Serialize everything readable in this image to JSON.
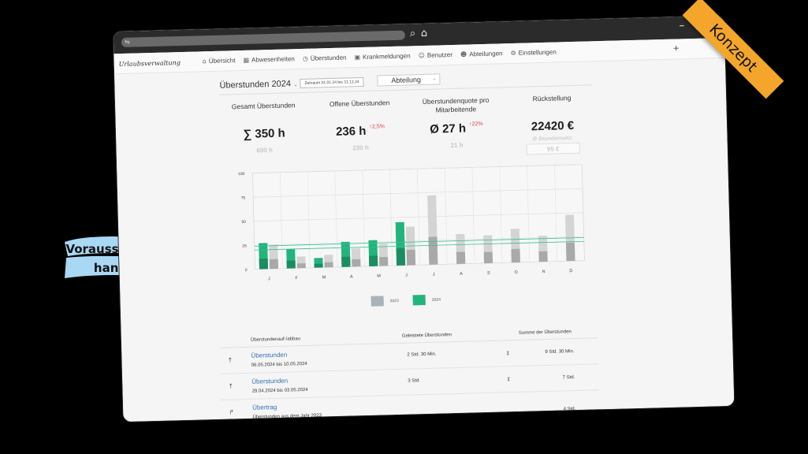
{
  "browser": {
    "icons": [
      "search-icon",
      "home-icon"
    ],
    "window_controls": [
      "minimize-icon",
      "maximize-icon",
      "close-icon"
    ]
  },
  "app": {
    "brand": "Urlaubsverwaltung"
  },
  "nav": {
    "items": [
      {
        "label": "Übersicht",
        "icon": "home-icon"
      },
      {
        "label": "Abwesenheiten",
        "icon": "calendar-icon"
      },
      {
        "label": "Überstunden",
        "icon": "clock-icon"
      },
      {
        "label": "Krankmeldungen",
        "icon": "medical-icon"
      },
      {
        "label": "Benutzer",
        "icon": "user-icon"
      },
      {
        "label": "Abteilungen",
        "icon": "users-icon"
      },
      {
        "label": "Einstellungen",
        "icon": "gear-icon"
      }
    ],
    "plus": "+"
  },
  "filters": {
    "year": "Überstunden 2024",
    "period": "Zeitraum 01.01.24 bis 31.12.24",
    "department": "Abteilung"
  },
  "kpis": [
    {
      "label": "Gesamt Überstunden",
      "value": "∑ 350 h",
      "trend": "",
      "previous": "600 h"
    },
    {
      "label": "Offene Überstunden",
      "value": "236 h",
      "trend": "↑2,5%",
      "previous": "230 h"
    },
    {
      "label": "Überstundenquote pro Mitarbeitende",
      "value": "Ø 27 h",
      "trend": "↑22%",
      "previous": "21 h"
    },
    {
      "label": "Rückstellung",
      "value": "22420 €",
      "trend": "",
      "sub_label": "Ø Stundensatz:",
      "sub_value": "95 €"
    }
  ],
  "chart_data": {
    "type": "bar",
    "categories": [
      "J",
      "F",
      "M",
      "A",
      "M",
      "J",
      "J",
      "A",
      "S",
      "O",
      "N",
      "D"
    ],
    "ylim": [
      0,
      100
    ],
    "yticks": [
      0,
      25,
      50,
      75,
      100
    ],
    "series": [
      {
        "name": "2023",
        "values": [
          25,
          12,
          13,
          19,
          23,
          40,
          72,
          31,
          29,
          35,
          27,
          48
        ]
      },
      {
        "name": "2024",
        "values": [
          27,
          20,
          10,
          26,
          27,
          45,
          null,
          null,
          null,
          null,
          null,
          null
        ]
      }
    ],
    "reference_lines": [
      20,
      24
    ],
    "colors": {
      "2023": "#b0b8bf",
      "2024": "#23b47e"
    }
  },
  "table": {
    "headers": [
      "Überstundenauf-/abbau",
      "Geleistete Überstunden",
      "Summe der Überstunden"
    ],
    "rows": [
      {
        "icon": "arrow-up-icon",
        "arrow": "↑",
        "title": "Überstunden",
        "range": "06.05.2024 bis 10.05.2024",
        "done": "2 Std. 30 Min.",
        "sigma": "Σ",
        "sum": "9 Std. 30 Min."
      },
      {
        "icon": "arrow-up-icon",
        "arrow": "↑",
        "title": "Überstunden",
        "range": "29.04.2024 bis 03.05.2024",
        "done": "3 Std.",
        "sigma": "Σ",
        "sum": "7 Std."
      },
      {
        "icon": "forward-icon",
        "arrow": "↱",
        "title": "Übertrag",
        "range": "Überstunden aus dem Jahr 2023",
        "done": "",
        "sigma": "",
        "sum": "4 Std."
      }
    ]
  },
  "ribbon": {
    "label": "Konzept",
    "color": "#f3a62b"
  },
  "annotation": {
    "line1": "Vorausschauend",
    "line2": "handeln",
    "brush_color": "#a8d8f4"
  }
}
